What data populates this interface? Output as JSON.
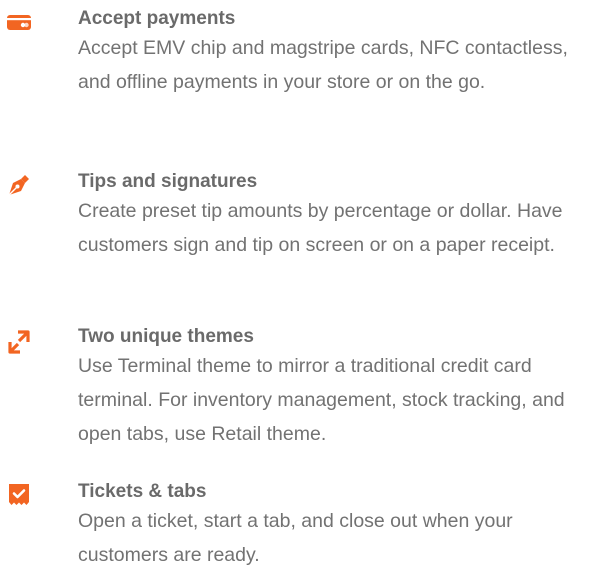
{
  "colors": {
    "accent": "#f26522",
    "title": "#6a6a6a",
    "text": "#727272"
  },
  "features": [
    {
      "icon": "card-reader-icon",
      "title": "Accept payments",
      "description": "Accept EMV chip and magstripe cards, NFC contactless, and offline payments in your store or on the go."
    },
    {
      "icon": "pen-nib-icon",
      "title": "Tips and signatures",
      "description": "Create preset tip amounts by percentage or dollar. Have customers sign and tip on screen or on a paper receipt."
    },
    {
      "icon": "swap-arrows-icon",
      "title": "Two unique themes",
      "description": "Use Terminal theme to mirror a traditional credit card terminal. For inventory management, stock tracking, and open tabs, use Retail theme."
    },
    {
      "icon": "ticket-check-icon",
      "title": "Tickets & tabs",
      "description": "Open a ticket, start a tab, and close out when your customers are ready."
    }
  ]
}
